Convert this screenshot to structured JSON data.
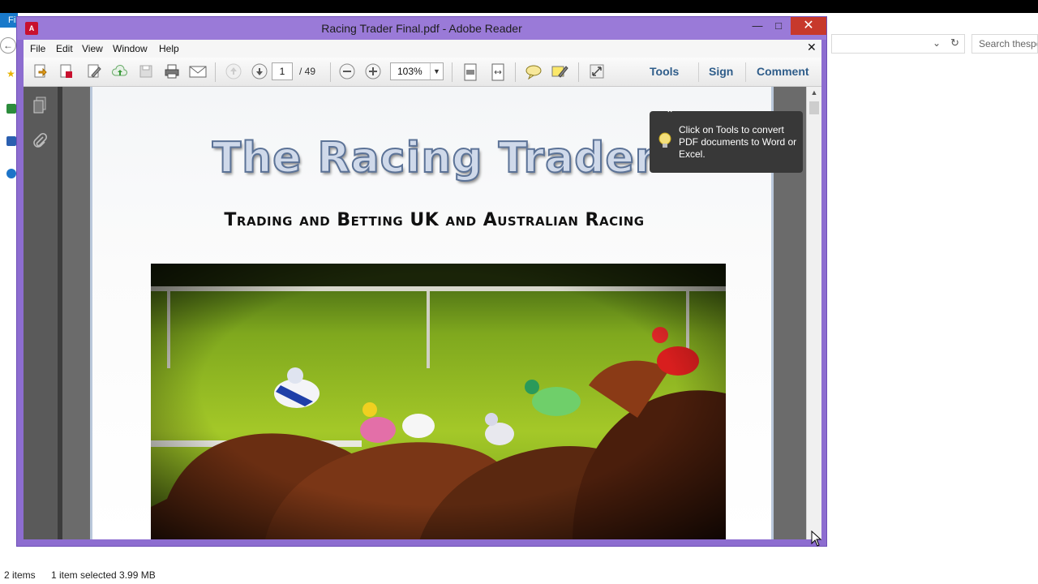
{
  "explorer": {
    "tab_fragment": "Fil",
    "search_placeholder": "Search thespo",
    "status_items": "2 items",
    "status_selected": "1 item selected  3.99 MB"
  },
  "reader": {
    "window_title": "Racing Trader Final.pdf - Adobe Reader",
    "menu": [
      "File",
      "Edit",
      "View",
      "Window",
      "Help"
    ],
    "page_current": "1",
    "page_total": "/ 49",
    "zoom": "103%",
    "links": {
      "tools": "Tools",
      "sign": "Sign",
      "comment": "Comment"
    },
    "tooltip": "Click on Tools to convert PDF documents to Word or Excel."
  },
  "document": {
    "title": "The Racing Trader",
    "subtitle": "Trading and Betting UK and Australian Racing"
  },
  "colors": {
    "window_frame": "#8d6dd0",
    "close_button": "#c7392c",
    "link_text": "#2f5d8a",
    "title_fill": "#cfd9ea",
    "title_stroke": "#5c7397"
  },
  "icons": [
    "create-pdf-icon",
    "open-icon",
    "edit-icon",
    "upload-icon",
    "save-icon",
    "print-icon",
    "email-icon",
    "prev-page-icon",
    "next-page-icon",
    "zoom-out-icon",
    "zoom-in-icon",
    "fit-page-icon",
    "fit-width-icon",
    "comment-icon",
    "highlight-icon",
    "read-mode-icon",
    "pages-icon",
    "attachment-icon",
    "lightbulb-icon",
    "mouse-cursor-icon"
  ]
}
